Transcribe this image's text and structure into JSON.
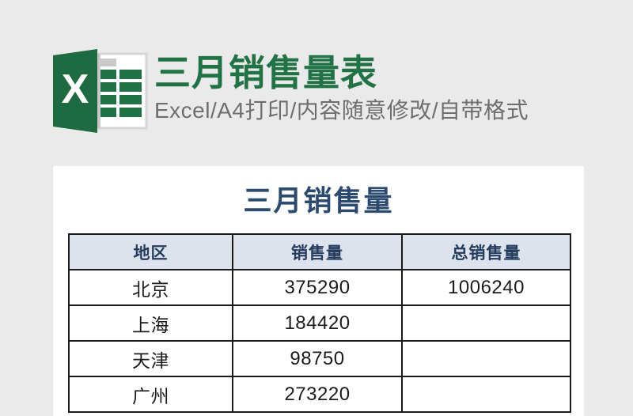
{
  "background_color": "#eaeaea",
  "banner": {
    "logo_icon": "excel-logo-icon",
    "logo_letter": "X",
    "logo_color": "#217346",
    "title": "三月销售量表",
    "title_color": "#217346",
    "subtitle": "Excel/A4打印/内容随意修改/自带格式",
    "subtitle_color": "#6e6e6e"
  },
  "sheet": {
    "background_color": "#ffffff",
    "doc_title": "三月销售量",
    "doc_title_color": "#2b4a6f"
  },
  "table": {
    "header_background": "#dce3ec",
    "header_text_color": "#243c5e",
    "border_color": "#1a1a1a",
    "columns": [
      "地区",
      "销售量",
      "总销售量"
    ],
    "rows": [
      {
        "region": "北京",
        "sales": "375290",
        "total": "1006240"
      },
      {
        "region": "上海",
        "sales": "184420",
        "total": ""
      },
      {
        "region": "天津",
        "sales": "98750",
        "total": ""
      },
      {
        "region": "广州",
        "sales": "273220",
        "total": ""
      }
    ]
  },
  "chart_data": {
    "type": "table",
    "title": "三月销售量",
    "columns": [
      "地区",
      "销售量",
      "总销售量"
    ],
    "categories": [
      "北京",
      "上海",
      "天津",
      "广州"
    ],
    "values": [
      375290,
      184420,
      98750,
      273220
    ],
    "total": 1006240,
    "ylabel": "销售量"
  }
}
